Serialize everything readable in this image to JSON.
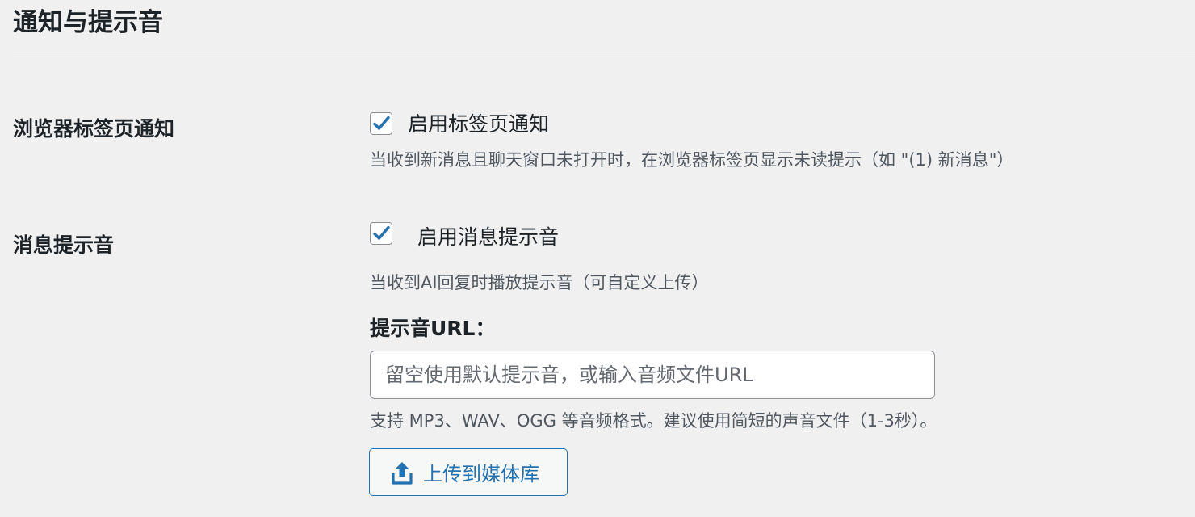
{
  "section": {
    "title": "通知与提示音"
  },
  "tab_notification": {
    "label": "浏览器标签页通知",
    "checkbox_label": "启用标签页通知",
    "checked": true,
    "description": "当收到新消息且聊天窗口未打开时，在浏览器标签页显示未读提示（如 \"(1) 新消息\"）"
  },
  "sound_notification": {
    "label": "消息提示音",
    "checkbox_label": "启用消息提示音",
    "checked": true,
    "description": "当收到AI回复时播放提示音（可自定义上传）",
    "url_label": "提示音URL：",
    "url_value": "",
    "url_placeholder": "留空使用默认提示音，或输入音频文件URL",
    "format_hint": "支持 MP3、WAV、OGG 等音频格式。建议使用简短的声音文件（1-3秒）。",
    "upload_button_label": "上传到媒体库",
    "upload_icon": "upload-icon"
  },
  "colors": {
    "background": "#f0f0f1",
    "accent": "#2271b1",
    "text": "#1d2327",
    "muted_text": "#50575e"
  }
}
